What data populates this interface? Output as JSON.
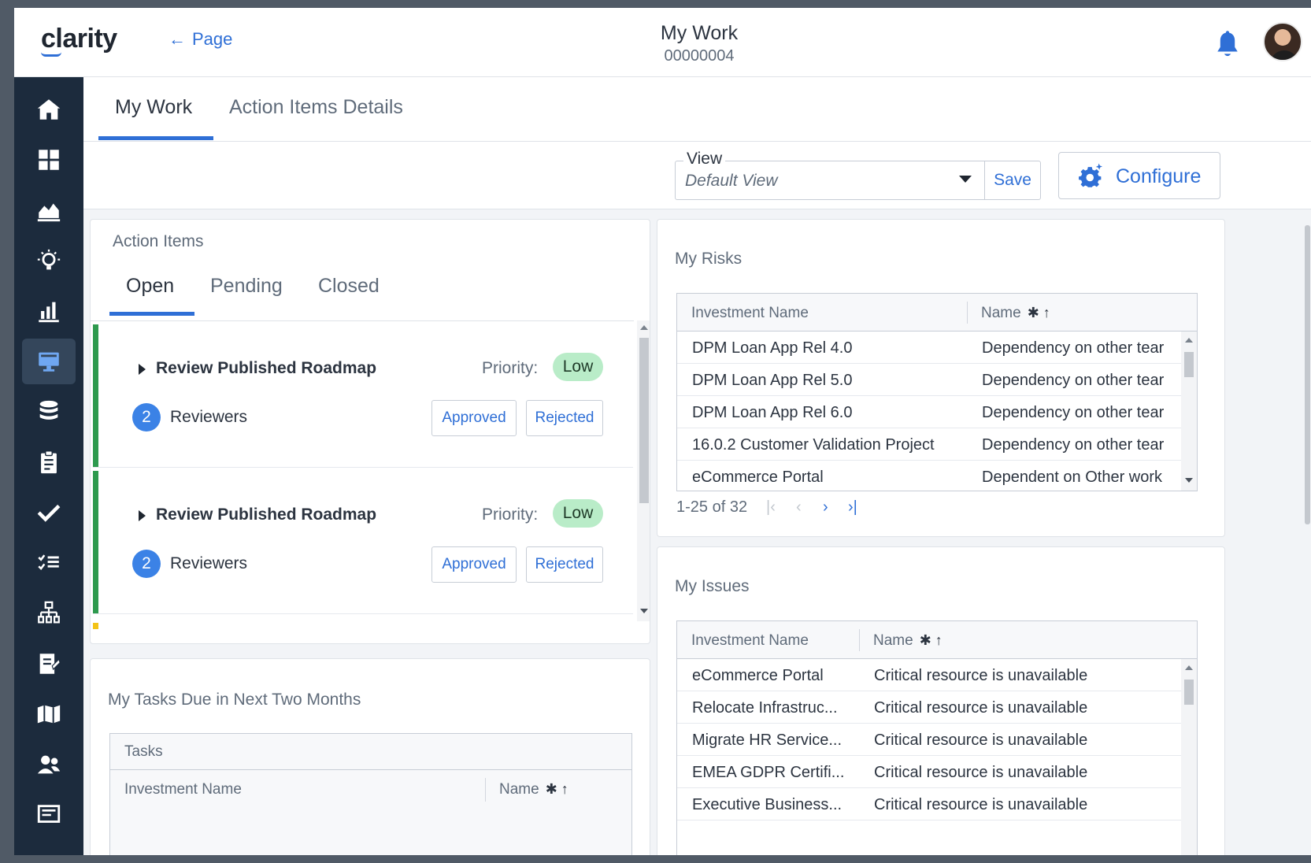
{
  "header": {
    "logo": "clarity",
    "back_label": "Page",
    "title": "My Work",
    "subtitle": "00000004"
  },
  "sidebar": {
    "items": [
      {
        "icon": "home-icon"
      },
      {
        "icon": "dashboard-grid-icon"
      },
      {
        "icon": "area-chart-icon"
      },
      {
        "icon": "lightbulb-icon"
      },
      {
        "icon": "bar-chart-icon"
      },
      {
        "icon": "monitor-icon",
        "active": true
      },
      {
        "icon": "database-icon"
      },
      {
        "icon": "clipboard-icon"
      },
      {
        "icon": "checkmark-icon"
      },
      {
        "icon": "checklist-icon"
      },
      {
        "icon": "org-chart-icon"
      },
      {
        "icon": "timesheet-icon"
      },
      {
        "icon": "map-icon"
      },
      {
        "icon": "people-icon"
      },
      {
        "icon": "reports-icon"
      }
    ]
  },
  "tabs": [
    {
      "label": "My Work",
      "active": true
    },
    {
      "label": "Action Items Details",
      "active": false
    }
  ],
  "toolbar": {
    "view_label": "View",
    "view_value": "Default View",
    "save_label": "Save",
    "configure_label": "Configure"
  },
  "action_items": {
    "title": "Action Items",
    "tabs": [
      {
        "label": "Open",
        "active": true
      },
      {
        "label": "Pending",
        "active": false
      },
      {
        "label": "Closed",
        "active": false
      }
    ],
    "items": [
      {
        "title": "Review Published Roadmap",
        "priority_label": "Priority:",
        "priority": "Low",
        "reviewer_count": "2",
        "reviewer_label": "Reviewers",
        "approve_label": "Approved",
        "reject_label": "Rejected"
      },
      {
        "title": "Review Published Roadmap",
        "priority_label": "Priority:",
        "priority": "Low",
        "reviewer_count": "2",
        "reviewer_label": "Reviewers",
        "approve_label": "Approved",
        "reject_label": "Rejected"
      }
    ]
  },
  "my_tasks": {
    "title": "My Tasks Due in Next Two Months",
    "group_header": "Tasks",
    "columns": [
      "Investment Name",
      "Name"
    ]
  },
  "my_risks": {
    "title": "My Risks",
    "columns": [
      "Investment Name",
      "Name"
    ],
    "rows": [
      [
        "DPM Loan App Rel 4.0",
        "Dependency on other tear"
      ],
      [
        "DPM Loan App Rel 5.0",
        "Dependency on other tear"
      ],
      [
        "DPM Loan App Rel 6.0",
        "Dependency on other tear"
      ],
      [
        "16.0.2 Customer Validation Project",
        "Dependency on other tear"
      ],
      [
        "eCommerce Portal",
        "Dependent on Other work"
      ]
    ],
    "pager": "1-25 of 32"
  },
  "my_issues": {
    "title": "My Issues",
    "columns": [
      "Investment Name",
      "Name"
    ],
    "rows": [
      [
        "eCommerce Portal",
        "Critical resource is unavailable"
      ],
      [
        "Relocate Infrastruc...",
        "Critical resource is unavailable"
      ],
      [
        "Migrate HR Service...",
        "Critical resource is unavailable"
      ],
      [
        "EMEA GDPR Certifi...",
        "Critical resource is unavailable"
      ],
      [
        "Executive Business...",
        "Critical resource is unavailable"
      ]
    ]
  },
  "colors": {
    "accent": "#2f6fd6",
    "sidebar_bg": "#1c2b3d",
    "sidebar_active": "#34465b",
    "status_green": "#2e9a4e",
    "priority_low_bg": "#b9ecc8",
    "reviewer_badge": "#3b82e6",
    "pending_yellow": "#f3c317"
  }
}
